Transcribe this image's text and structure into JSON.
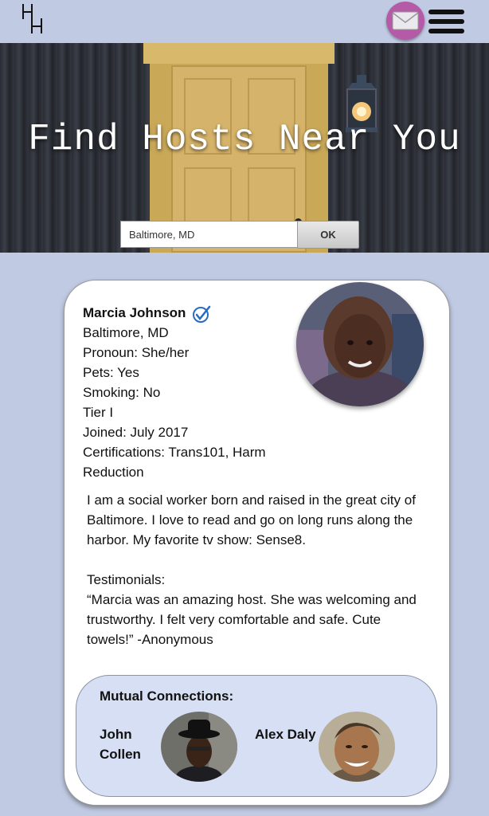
{
  "header": {
    "logo_text": "HH",
    "mail_icon": "envelope-icon",
    "menu_icon": "hamburger-menu-icon"
  },
  "hero": {
    "title": "Find Hosts Near You",
    "search_value": "Baltimore, MD",
    "ok_label": "OK"
  },
  "host": {
    "name": "Marcia Johnson",
    "location": "Baltimore, MD",
    "pronoun": "Pronoun: She/her",
    "pets": "Pets: Yes",
    "smoking": "Smoking: No",
    "tier": "Tier I",
    "joined": "Joined: July 2017",
    "certifications": "Certifications: Trans101, Harm Reduction",
    "bio": "I am a social worker born and raised in the great city of Baltimore. I love to read and go on long runs along the harbor. My favorite tv show: Sense8.",
    "testimonials_label": "Testimonials:",
    "testimonial": "“Marcia was an amazing host. She was welcoming and trustworthy. I felt very comfortable and safe. Cute towels!” -Anonymous"
  },
  "mutual": {
    "title": "Mutual Connections:",
    "connections": [
      {
        "name_line1": "John",
        "name_line2": "Collen"
      },
      {
        "name_line1": "Alex Daly",
        "name_line2": ""
      }
    ]
  },
  "colors": {
    "page_bg": "#c0cae3",
    "mail_button": "#b45aa6",
    "verified_blue": "#2a6bbf",
    "mutual_bg": "#d6dff3"
  }
}
